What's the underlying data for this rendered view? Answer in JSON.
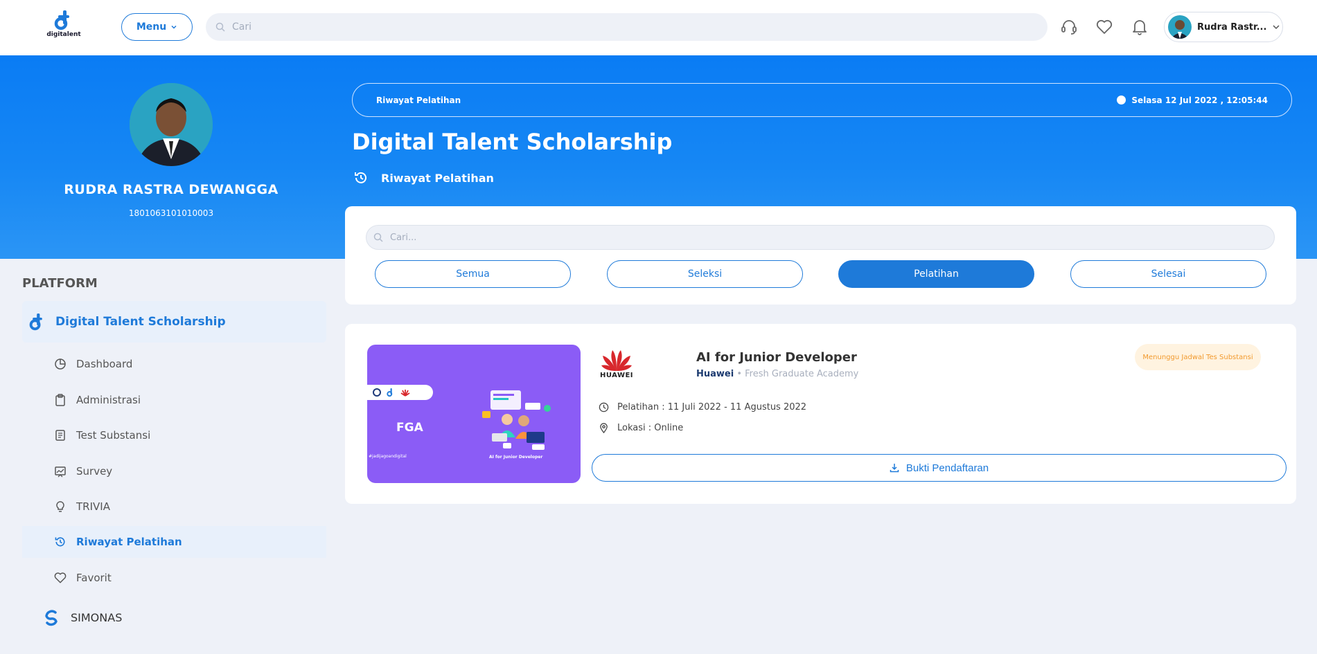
{
  "brand": {
    "logo_text": "digitalent"
  },
  "topbar": {
    "menu_label": "Menu",
    "search_placeholder": "Cari",
    "user_name": "Rudra Rastr..."
  },
  "profile": {
    "name": "RUDRA RASTRA DEWANGGA",
    "id": "1801063101010003"
  },
  "header": {
    "breadcrumb": "Riwayat Pelatihan",
    "datetime": "Selasa 12 Jul 2022 , 12:05:44",
    "title": "Digital Talent Scholarship",
    "subtitle": "Riwayat Pelatihan"
  },
  "sidebar": {
    "heading": "PLATFORM",
    "main_item": "Digital Talent Scholarship",
    "items": [
      {
        "label": "Dashboard",
        "icon": "pie-chart-icon"
      },
      {
        "label": "Administrasi",
        "icon": "clipboard-icon"
      },
      {
        "label": "Test Substansi",
        "icon": "document-icon"
      },
      {
        "label": "Survey",
        "icon": "chart-board-icon"
      },
      {
        "label": "TRIVIA",
        "icon": "lightbulb-icon"
      },
      {
        "label": "Riwayat Pelatihan",
        "icon": "history-icon",
        "active": true
      },
      {
        "label": "Favorit",
        "icon": "heart-icon"
      }
    ],
    "simonas_label": "SIMONAS"
  },
  "filter": {
    "search_placeholder": "Cari...",
    "tabs": [
      {
        "label": "Semua",
        "active": false
      },
      {
        "label": "Seleksi",
        "active": false
      },
      {
        "label": "Pelatihan",
        "active": true
      },
      {
        "label": "Selesai",
        "active": false
      }
    ]
  },
  "course": {
    "title": "AI for Junior Developer",
    "organizer": "Huawei",
    "academy": "• Fresh Graduate Academy",
    "brand_word": "HUAWEI",
    "status": "Menunggu Jadwal Tes Substansi",
    "schedule": "Pelatihan : 11 Juli 2022 - 11 Agustus 2022",
    "location": "Lokasi : Online",
    "action_label": "Bukti Pendaftaran",
    "thumb": {
      "fga": "FGA",
      "tagline": "#jadijagoandigital",
      "caption": "AI for Junior Developer"
    }
  },
  "colors": {
    "primary": "#1e7ad9",
    "band": "#0a7cf4",
    "status_text": "#f29a2e",
    "status_bg": "#fff3e0",
    "thumb_bg": "#8b5cf6"
  }
}
